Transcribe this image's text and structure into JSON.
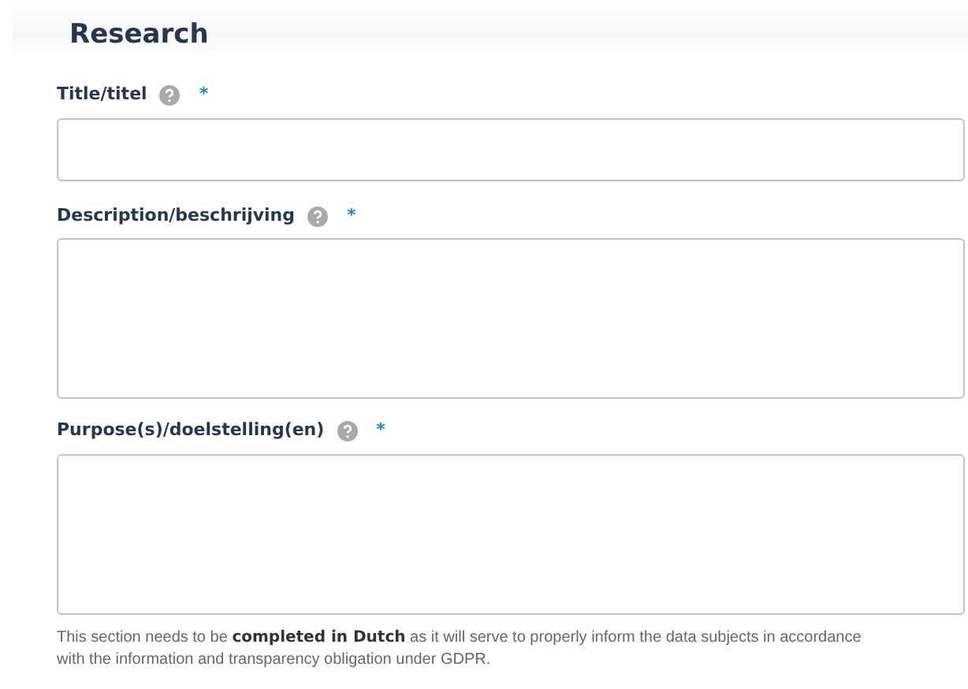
{
  "section": {
    "title": "Research"
  },
  "fields": [
    {
      "label": "Title/titel",
      "required_mark": "*",
      "kind": "input",
      "help": true
    },
    {
      "label": "Description/beschrijving",
      "required_mark": "*",
      "kind": "textarea",
      "help": true
    },
    {
      "label": "Purpose(s)/doelstelling(en)",
      "required_mark": "*",
      "kind": "textarea",
      "help": true
    }
  ],
  "note": "This section needs to be **completed in Dutch** as it will serve to properly inform the data subjects in accordance with the information and transparency obligation under GDPR."
}
